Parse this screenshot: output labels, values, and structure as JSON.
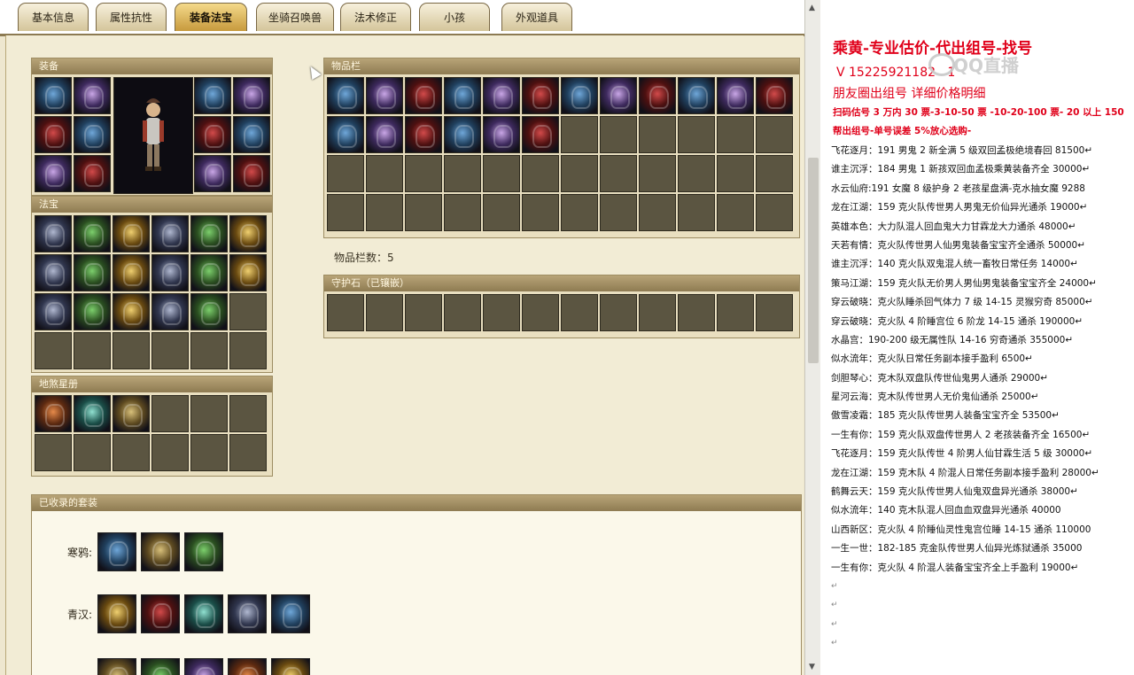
{
  "tabs": [
    {
      "label": "基本信息"
    },
    {
      "label": "属性抗性"
    },
    {
      "label": "装备法宝",
      "active": true
    },
    {
      "label": "坐骑召唤兽"
    },
    {
      "label": "法术修正"
    },
    {
      "label": "小孩"
    },
    {
      "label": "外观道具"
    }
  ],
  "panels": {
    "equipment": "装备",
    "treasure": "法宝",
    "constellation": "地煞星册",
    "inventory": "物品栏",
    "inventory_count": "物品栏数：5",
    "guardian": "守护石（已镶嵌）",
    "collected_suits": "已收录的套装"
  },
  "suits": [
    {
      "name": "寒鸦:",
      "count": 3
    },
    {
      "name": "青汉:",
      "count": 5
    },
    {
      "name": "",
      "count": 5
    }
  ],
  "doc": {
    "heading": "乘黄-专业估价-代出组号-找号",
    "contact": "V 15225921182",
    "contact_partial": "1",
    "wechat_note": "朋友圈出组号    详细价格明细",
    "pricing": "扫码估号 3 万内 30 票-3-10-50 票  -10-20-100 票- 20 以上 150",
    "note": "帮出组号-单号误差 5%放心选购-",
    "watermark": "QQ直播",
    "lines": [
      "飞花逐月：191 男鬼 2 新全满 5 级双回孟极绝境春回 81500↵",
      "谁主沉浮：184 男鬼 1 新孩双回血孟极乘黄装备齐全 30000↵",
      "水云仙府:191 女魔 8 级护身 2 老孩星盘满-克水抽女魔 9288",
      "龙在江湖：159 克火队传世男人男鬼无价仙异光通杀 19000↵",
      "英雄本色：大力队混人回血鬼大力甘霖龙大力通杀 48000↵",
      "天若有情：克火队传世男人仙男鬼装备宝宝齐全通杀 50000↵",
      "谁主沉浮：140 克火队双鬼混人统一畜牧日常任务 14000↵",
      "策马江湖：159 克火队无价男人男仙男鬼装备宝宝齐全 24000↵",
      "穿云破晓：克火队睡杀回气体力 7 级 14-15 灵猴穷奇 85000↵",
      "穿云破晓：克火队 4 阶睡宫位 6 阶龙 14-15 通杀 190000↵",
      "水晶宫：190-200 级无属性队 14-16 穷奇通杀 355000↵",
      "似水流年：克火队日常任务副本接手盈利 6500↵",
      "剑胆琴心：克木队双盘队传世仙鬼男人通杀 29000↵",
      "星河云海：克木队传世男人无价鬼仙通杀 25000↵",
      "傲雪凌霜：185 克火队传世男人装备宝宝齐全 53500↵",
      "一生有你：159 克火队双盘传世男人 2 老孩装备齐全 16500↵",
      "飞花逐月：159 克火队传世 4 阶男人仙甘霖生活 5 级 30000↵",
      "龙在江湖：159 克木队 4 阶混人日常任务副本接手盈利 28000↵",
      "鹤舞云天：159 克火队传世男人仙鬼双盘异光通杀 38000↵",
      "似水流年：140 克木队混人回血血双盘异光通杀 40000",
      "山西新区：克火队 4 阶睡仙灵性鬼宫位睡 14-15 通杀 110000",
      "一生一世：182-185 克金队传世男人仙异光炼狱通杀 35000",
      "一生有你：克火队 4 阶混人装备宝宝齐全上手盈利 19000↵",
      "↵",
      "↵",
      "↵",
      "↵"
    ]
  }
}
